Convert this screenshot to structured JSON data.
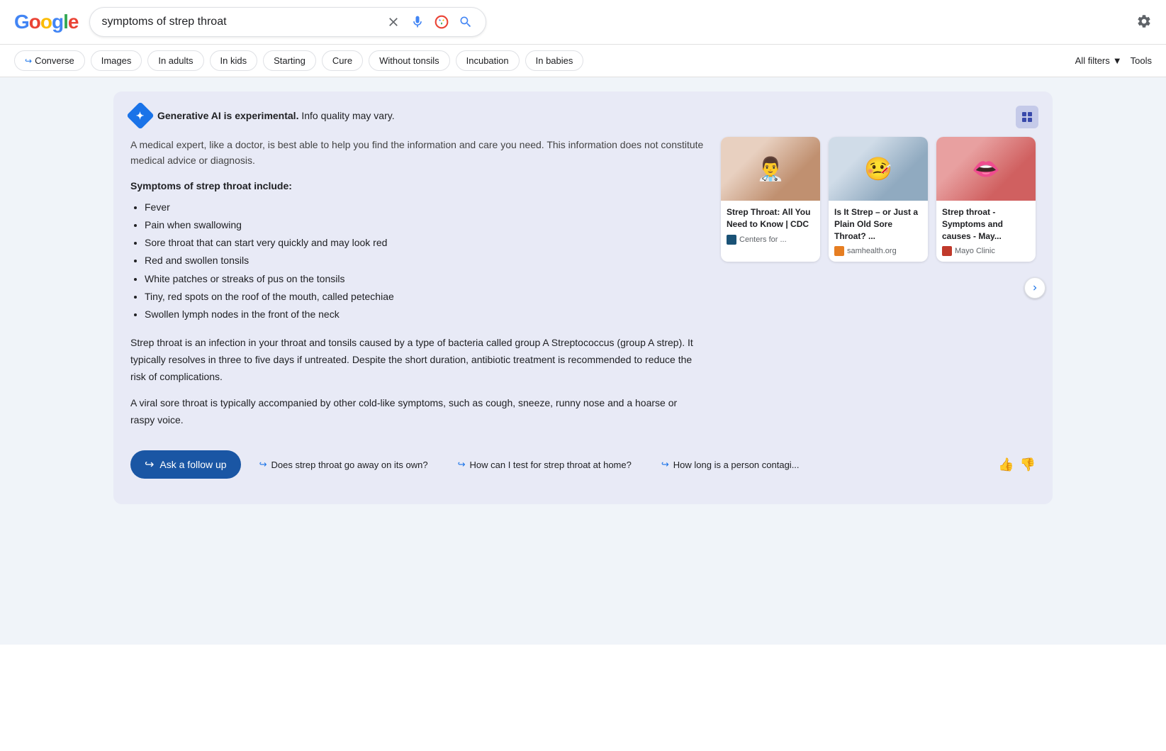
{
  "header": {
    "logo": "Google",
    "logo_parts": [
      "G",
      "o",
      "o",
      "g",
      "l",
      "e"
    ],
    "search_value": "symptoms of strep throat",
    "settings_label": "Settings"
  },
  "filters": {
    "chips": [
      {
        "label": "Converse",
        "arrow": true
      },
      {
        "label": "Images",
        "arrow": false
      },
      {
        "label": "In adults",
        "arrow": false
      },
      {
        "label": "In kids",
        "arrow": false
      },
      {
        "label": "Starting",
        "arrow": false
      },
      {
        "label": "Cure",
        "arrow": false
      },
      {
        "label": "Without tonsils",
        "arrow": false
      },
      {
        "label": "Incubation",
        "arrow": false
      },
      {
        "label": "In babies",
        "arrow": false
      }
    ],
    "all_filters": "All filters",
    "tools": "Tools"
  },
  "ai_section": {
    "header_bold": "Generative AI is experimental.",
    "header_text": " Info quality may vary.",
    "disclaimer": "A medical expert, like a doctor, is best able to help you find the information and care you need. This information does not constitute medical advice or diagnosis.",
    "symptoms_header": "Symptoms of strep throat include:",
    "symptoms": [
      "Fever",
      "Pain when swallowing",
      "Sore throat that can start very quickly and may look red",
      "Red and swollen tonsils",
      "White patches or streaks of pus on the tonsils",
      "Tiny, red spots on the roof of the mouth, called petechiae",
      "Swollen lymph nodes in the front of the neck"
    ],
    "para1": "Strep throat is an infection in your throat and tonsils caused by a type of bacteria called group A Streptococcus (group A strep). It typically resolves in three to five days if untreated. Despite the short duration, antibiotic treatment is recommended to reduce the risk of complications.",
    "para2": "A viral sore throat is typically accompanied by other cold-like symptoms, such as cough, sneeze, runny nose and a hoarse or raspy voice.",
    "cards": [
      {
        "title": "Strep Throat: All You Need to Know | CDC",
        "source": "Centers for ...",
        "source_class": "cdc-icon",
        "emoji": "👨‍⚕️"
      },
      {
        "title": "Is It Strep – or Just a Plain Old Sore Throat? ...",
        "source": "samhealth.org",
        "source_class": "sam-icon",
        "emoji": "🤒"
      },
      {
        "title": "Strep throat - Symptoms and causes - May...",
        "source": "Mayo Clinic",
        "source_class": "mayo-icon",
        "emoji": "👄"
      }
    ]
  },
  "bottom": {
    "follow_up_label": "Ask a follow up",
    "suggestions": [
      "Does strep throat go away on its own?",
      "How can I test for strep throat at home?",
      "How long is a person contagi..."
    ],
    "thumbs_up": "👍",
    "thumbs_down": "👎"
  }
}
